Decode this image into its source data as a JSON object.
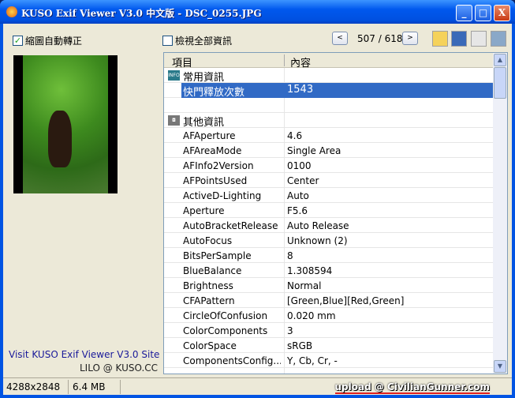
{
  "window": {
    "title": "KUSO Exif Viewer V3.0 中文版 - DSC_0255.JPG",
    "minimize": "_",
    "maximize": "□",
    "close": "X"
  },
  "left": {
    "auto_rotate_label": "縮圖自動轉正",
    "auto_rotate_checked": true,
    "site_link": "Visit KUSO Exif Viewer V3.0 Site",
    "credit": "LILO @ KUSO.CC"
  },
  "toolbar": {
    "show_all_label": "檢視全部資訊",
    "show_all_checked": false,
    "prev": "<",
    "next": ">",
    "page": "507 / 618"
  },
  "table": {
    "headers": [
      "項目",
      "內容"
    ],
    "groups": [
      {
        "icon": "info-icon",
        "label": "常用資訊"
      },
      {
        "icon": "camera-icon",
        "label": "其他資訊"
      }
    ],
    "selected": {
      "key": "快門釋放次數",
      "value": "1543"
    },
    "rows": [
      [
        "AFAperture",
        "4.6"
      ],
      [
        "AFAreaMode",
        "Single Area"
      ],
      [
        "AFInfo2Version",
        "0100"
      ],
      [
        "AFPointsUsed",
        "Center"
      ],
      [
        "ActiveD-Lighting",
        "Auto"
      ],
      [
        "Aperture",
        "F5.6"
      ],
      [
        "AutoBracketRelease",
        "Auto Release"
      ],
      [
        "AutoFocus",
        "Unknown (2)"
      ],
      [
        "BitsPerSample",
        "8"
      ],
      [
        "BlueBalance",
        "1.308594"
      ],
      [
        "Brightness",
        "Normal"
      ],
      [
        "CFAPattern",
        "[Green,Blue][Red,Green]"
      ],
      [
        "CircleOfConfusion",
        "0.020 mm"
      ],
      [
        "ColorComponents",
        "3"
      ],
      [
        "ColorSpace",
        "sRGB"
      ],
      [
        "ComponentsConfig...",
        "Y, Cb, Cr, -"
      ]
    ]
  },
  "status": {
    "dimensions": "4288x2848",
    "size": "6.4 MB",
    "watermark": "upload @ CivilianGunner.com"
  }
}
